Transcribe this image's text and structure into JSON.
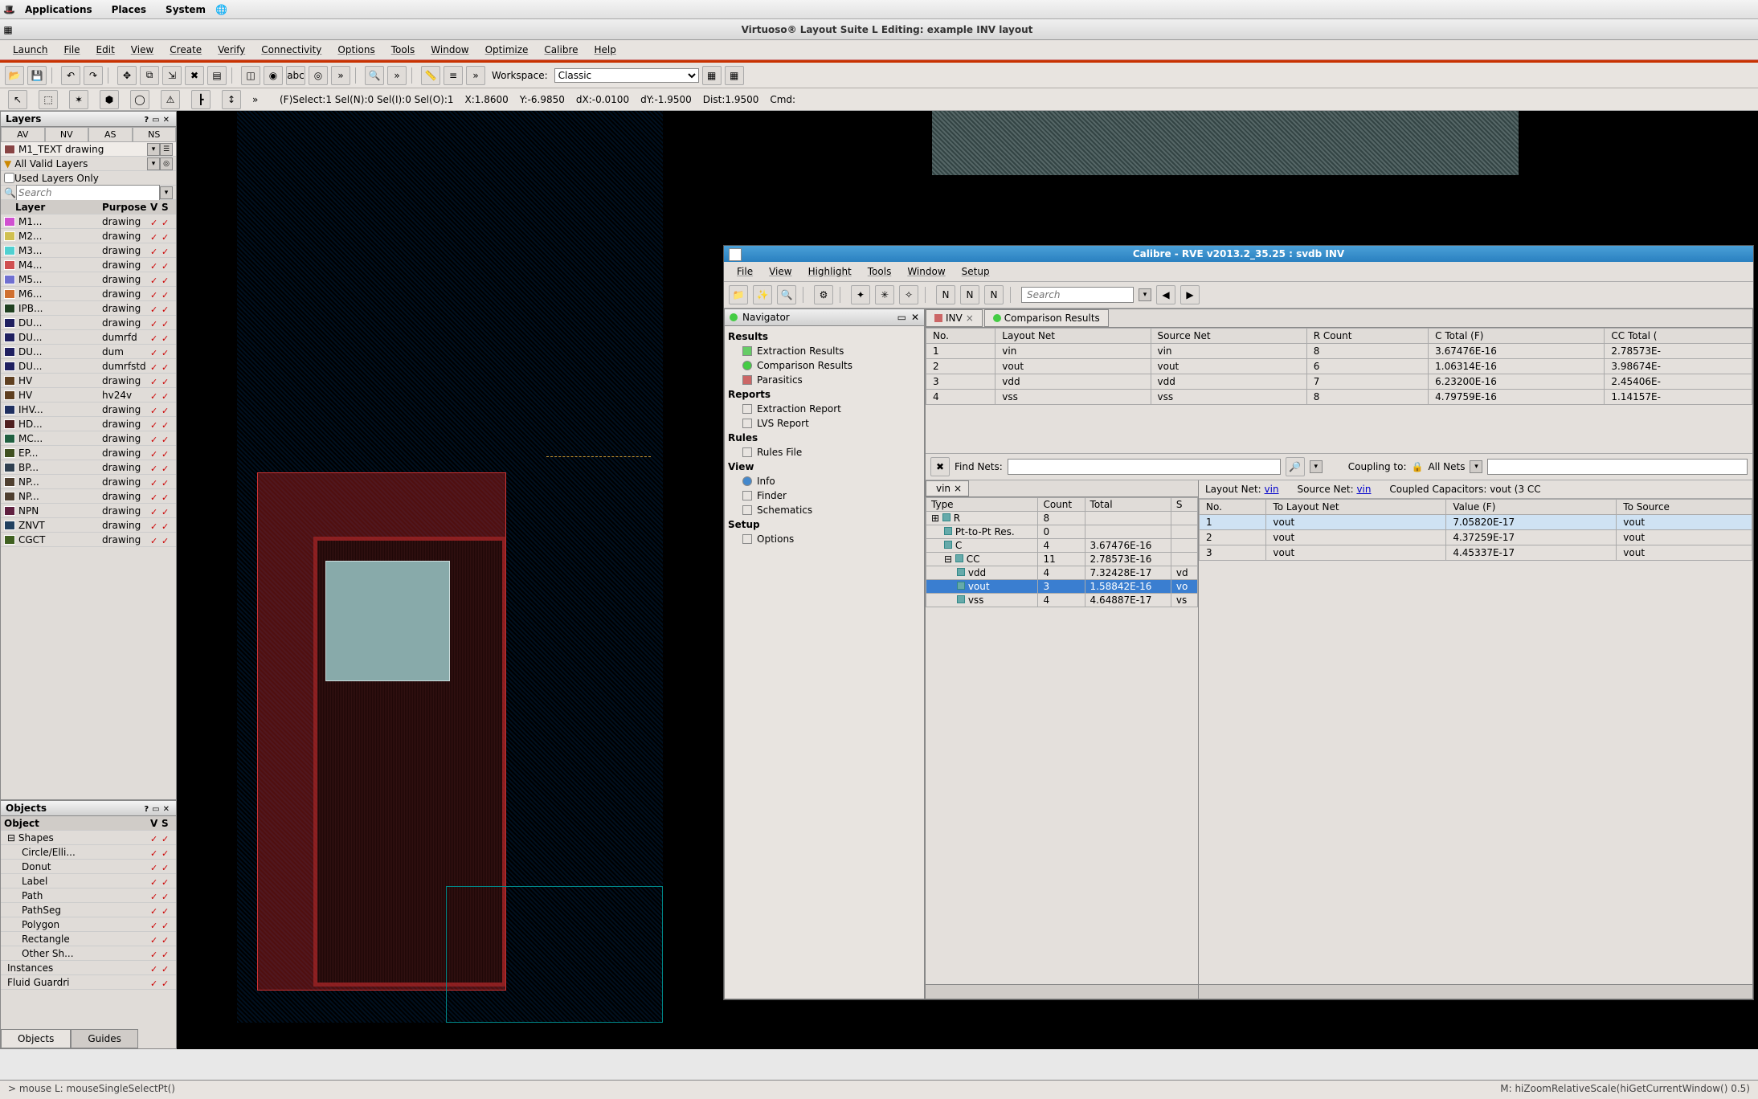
{
  "gnome": {
    "applications": "Applications",
    "places": "Places",
    "system": "System"
  },
  "virtuoso": {
    "title": "Virtuoso® Layout Suite L Editing: example INV layout",
    "menu": [
      "Launch",
      "File",
      "Edit",
      "View",
      "Create",
      "Verify",
      "Connectivity",
      "Options",
      "Tools",
      "Window",
      "Optimize",
      "Calibre",
      "Help"
    ],
    "workspace_label": "Workspace:",
    "workspace_value": "Classic",
    "status": {
      "sel_info": "(F)Select:1  Sel(N):0  Sel(I):0  Sel(O):1",
      "x": "X:1.8600",
      "y": "Y:-6.9850",
      "dx": "dX:-0.0100",
      "dy": "dY:-1.9500",
      "dist": "Dist:1.9500",
      "cmd": "Cmd:"
    }
  },
  "layers": {
    "title": "Layers",
    "tabs": [
      "AV",
      "NV",
      "AS",
      "NS"
    ],
    "current": "M1_TEXT drawing",
    "filter": "All Valid Layers",
    "usedonly": "Used Layers Only",
    "search_ph": "Search",
    "cols": [
      "Layer",
      "Purpose",
      "V",
      "S"
    ],
    "rows": [
      {
        "n": "M1...",
        "p": "drawing",
        "c": "#d050d0"
      },
      {
        "n": "M2...",
        "p": "drawing",
        "c": "#d0c050"
      },
      {
        "n": "M3...",
        "p": "drawing",
        "c": "#50d0d0"
      },
      {
        "n": "M4...",
        "p": "drawing",
        "c": "#d05050"
      },
      {
        "n": "M5...",
        "p": "drawing",
        "c": "#7070d0"
      },
      {
        "n": "M6...",
        "p": "drawing",
        "c": "#d07030"
      },
      {
        "n": "IPB...",
        "p": "drawing",
        "c": "#204020"
      },
      {
        "n": "DU...",
        "p": "drawing",
        "c": "#202060"
      },
      {
        "n": "DU...",
        "p": "dumrfd",
        "c": "#202060"
      },
      {
        "n": "DU...",
        "p": "dum",
        "c": "#202060"
      },
      {
        "n": "DU...",
        "p": "dumrfstd",
        "c": "#202060"
      },
      {
        "n": "HV",
        "p": "drawing",
        "c": "#604020"
      },
      {
        "n": "HV",
        "p": "hv24v",
        "c": "#604020"
      },
      {
        "n": "IHV...",
        "p": "drawing",
        "c": "#203060"
      },
      {
        "n": "HD...",
        "p": "drawing",
        "c": "#502020"
      },
      {
        "n": "MC...",
        "p": "drawing",
        "c": "#206040"
      },
      {
        "n": "EP...",
        "p": "drawing",
        "c": "#405020"
      },
      {
        "n": "BP...",
        "p": "drawing",
        "c": "#304050"
      },
      {
        "n": "NP...",
        "p": "drawing",
        "c": "#504030"
      },
      {
        "n": "NP...",
        "p": "drawing",
        "c": "#504030"
      },
      {
        "n": "NPN",
        "p": "drawing",
        "c": "#602040"
      },
      {
        "n": "ZNVT",
        "p": "drawing",
        "c": "#204060"
      },
      {
        "n": "CGCT",
        "p": "drawing",
        "c": "#406020"
      }
    ]
  },
  "objects": {
    "title": "Objects",
    "cols": [
      "Object",
      "V",
      "S"
    ],
    "tree": [
      "Shapes",
      "Circle/Elli...",
      "Donut",
      "Label",
      "Path",
      "PathSeg",
      "Polygon",
      "Rectangle",
      "Other Sh...",
      "Instances",
      "Fluid Guardri"
    ],
    "tabs": [
      "Objects",
      "Guides"
    ]
  },
  "calibre": {
    "title": "Calibre - RVE v2013.2_35.25 : svdb INV",
    "menu": [
      "File",
      "View",
      "Highlight",
      "Tools",
      "Window",
      "Setup"
    ],
    "search_ph": "Search",
    "nav_title": "Navigator",
    "nav": {
      "results_h": "Results",
      "results": [
        "Extraction Results",
        "Comparison Results",
        "Parasitics"
      ],
      "reports_h": "Reports",
      "reports": [
        "Extraction Report",
        "LVS Report"
      ],
      "rules_h": "Rules",
      "rules": [
        "Rules File"
      ],
      "view_h": "View",
      "view": [
        "Info",
        "Finder",
        "Schematics"
      ],
      "setup_h": "Setup",
      "setup": [
        "Options"
      ]
    },
    "tab_inv": "INV",
    "tab_comp": "Comparison Results",
    "net_cols": [
      "No.",
      "Layout Net",
      "Source Net",
      "R Count",
      "C Total (F)",
      "CC Total ("
    ],
    "nets": [
      {
        "no": "1",
        "ln": "vin",
        "sn": "vin",
        "rc": "8",
        "ct": "3.67476E-16",
        "cct": "2.78573E-"
      },
      {
        "no": "2",
        "ln": "vout",
        "sn": "vout",
        "rc": "6",
        "ct": "1.06314E-16",
        "cct": "3.98674E-"
      },
      {
        "no": "3",
        "ln": "vdd",
        "sn": "vdd",
        "rc": "7",
        "ct": "6.23200E-16",
        "cct": "2.45406E-"
      },
      {
        "no": "4",
        "ln": "vss",
        "sn": "vss",
        "rc": "8",
        "ct": "4.79759E-16",
        "cct": "1.14157E-"
      }
    ],
    "findnets_label": "Find Nets:",
    "coupling_label": "Coupling to:",
    "coupling_value": "All Nets",
    "vin_tab": "vin",
    "type_cols": [
      "Type",
      "Count",
      "Total",
      "S"
    ],
    "type_rows": [
      {
        "t": "R",
        "c": "8",
        "tot": "",
        "ind": 0,
        "exp": "⊞"
      },
      {
        "t": "Pt-to-Pt Res.",
        "c": "0",
        "tot": "",
        "ind": 1
      },
      {
        "t": "C",
        "c": "4",
        "tot": "3.67476E-16",
        "ind": 1
      },
      {
        "t": "CC",
        "c": "11",
        "tot": "2.78573E-16",
        "ind": 1,
        "exp": "⊟"
      },
      {
        "t": "vdd",
        "c": "4",
        "tot": "7.32428E-17",
        "ext": "vd",
        "ind": 2
      },
      {
        "t": "vout",
        "c": "3",
        "tot": "1.58842E-16",
        "ext": "vo",
        "ind": 2,
        "sel": true
      },
      {
        "t": "vss",
        "c": "4",
        "tot": "4.64887E-17",
        "ext": "vs",
        "ind": 2
      }
    ],
    "layout_net_label": "Layout Net:",
    "layout_net": "vin",
    "source_net_label": "Source Net:",
    "source_net": "vin",
    "coupled_label": "Coupled Capacitors: vout (3 CC",
    "caps_cols": [
      "No.",
      "To Layout Net",
      "Value (F)",
      "To Source"
    ],
    "caps": [
      {
        "no": "1",
        "ln": "vout",
        "v": "7.05820E-17",
        "sn": "vout",
        "sel": true
      },
      {
        "no": "2",
        "ln": "vout",
        "v": "4.37259E-17",
        "sn": "vout"
      },
      {
        "no": "3",
        "ln": "vout",
        "v": "4.45337E-17",
        "sn": "vout"
      }
    ]
  },
  "footer": {
    "left": "> mouse L: mouseSingleSelectPt()",
    "right": "M: hiZoomRelativeScale(hiGetCurrentWindow() 0.5)"
  }
}
